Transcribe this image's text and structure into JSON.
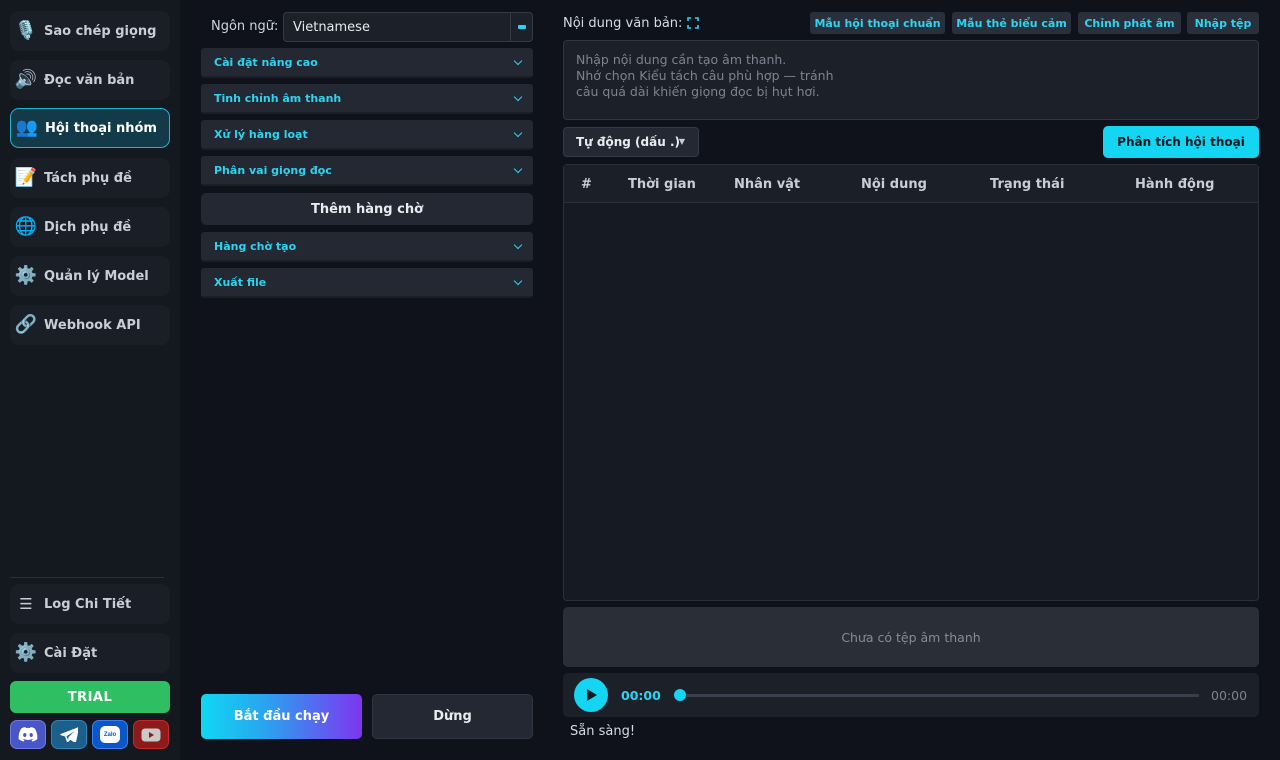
{
  "sidebar": {
    "items": [
      {
        "label": "Sao chép giọng",
        "icon": "🎙️"
      },
      {
        "label": "Đọc văn bản",
        "icon": "🔊"
      },
      {
        "label": "Hội thoại nhóm",
        "icon": "👥"
      },
      {
        "label": "Tách phụ đề",
        "icon": "📝"
      },
      {
        "label": "Dịch phụ đề",
        "icon": "🌐"
      },
      {
        "label": "Quản lý Model",
        "icon": "⚙️"
      },
      {
        "label": "Webhook API",
        "icon": "🔗"
      }
    ],
    "bottom_items": [
      {
        "label": "Log Chi Tiết",
        "icon": "☰"
      },
      {
        "label": "Cài Đặt",
        "icon": "⚙️"
      }
    ],
    "trial_label": "TRIAL",
    "social_icons": [
      "discord-icon",
      "telegram-icon",
      "zalo-icon",
      "youtube-icon"
    ],
    "zalo_text": "Zalo"
  },
  "left_panel": {
    "language_label": "Ngôn ngữ:",
    "language_value": "Vietnamese",
    "sections": [
      {
        "label": "Cài đặt nâng cao"
      },
      {
        "label": "Tinh chỉnh âm thanh"
      },
      {
        "label": "Xử lý hàng loạt"
      },
      {
        "label": "Phân vai giọng đọc"
      }
    ],
    "add_queue_label": "Thêm hàng chờ",
    "sections_after": [
      {
        "label": "Hàng chờ tạo"
      },
      {
        "label": "Xuất file"
      }
    ],
    "start_label": "Bắt đầu chạy",
    "stop_label": "Dừng"
  },
  "main": {
    "content_label": "Nội dung văn bản:",
    "toolbar": [
      "Mẫu hội thoại chuẩn",
      "Mẫu thẻ biểu cảm",
      "Chỉnh phát âm",
      "Nhập tệp"
    ],
    "text_placeholder": "Nhập nội dung cần tạo âm thanh.\nNhớ chọn Kiểu tách câu phù hợp — tránh\ncâu quá dài khiến giọng đọc bị hụt hơi.",
    "split_mode": "Tự động (dấu .)",
    "analyze_label": "Phân tích hội thoại",
    "table_columns": [
      "#",
      "Thời gian",
      "Nhân vật",
      "Nội dung",
      "Trạng thái",
      "Hành động"
    ],
    "no_audio_text": "Chưa có tệp âm thanh",
    "player": {
      "current_time": "00:00",
      "total_time": "00:00",
      "progress": 0
    },
    "status": "Sẵn sàng!"
  },
  "colors": {
    "accent": "#14d6f2",
    "active_border": "#1fb5cf",
    "trial": "#2fbf62",
    "background": "#0f121a"
  }
}
